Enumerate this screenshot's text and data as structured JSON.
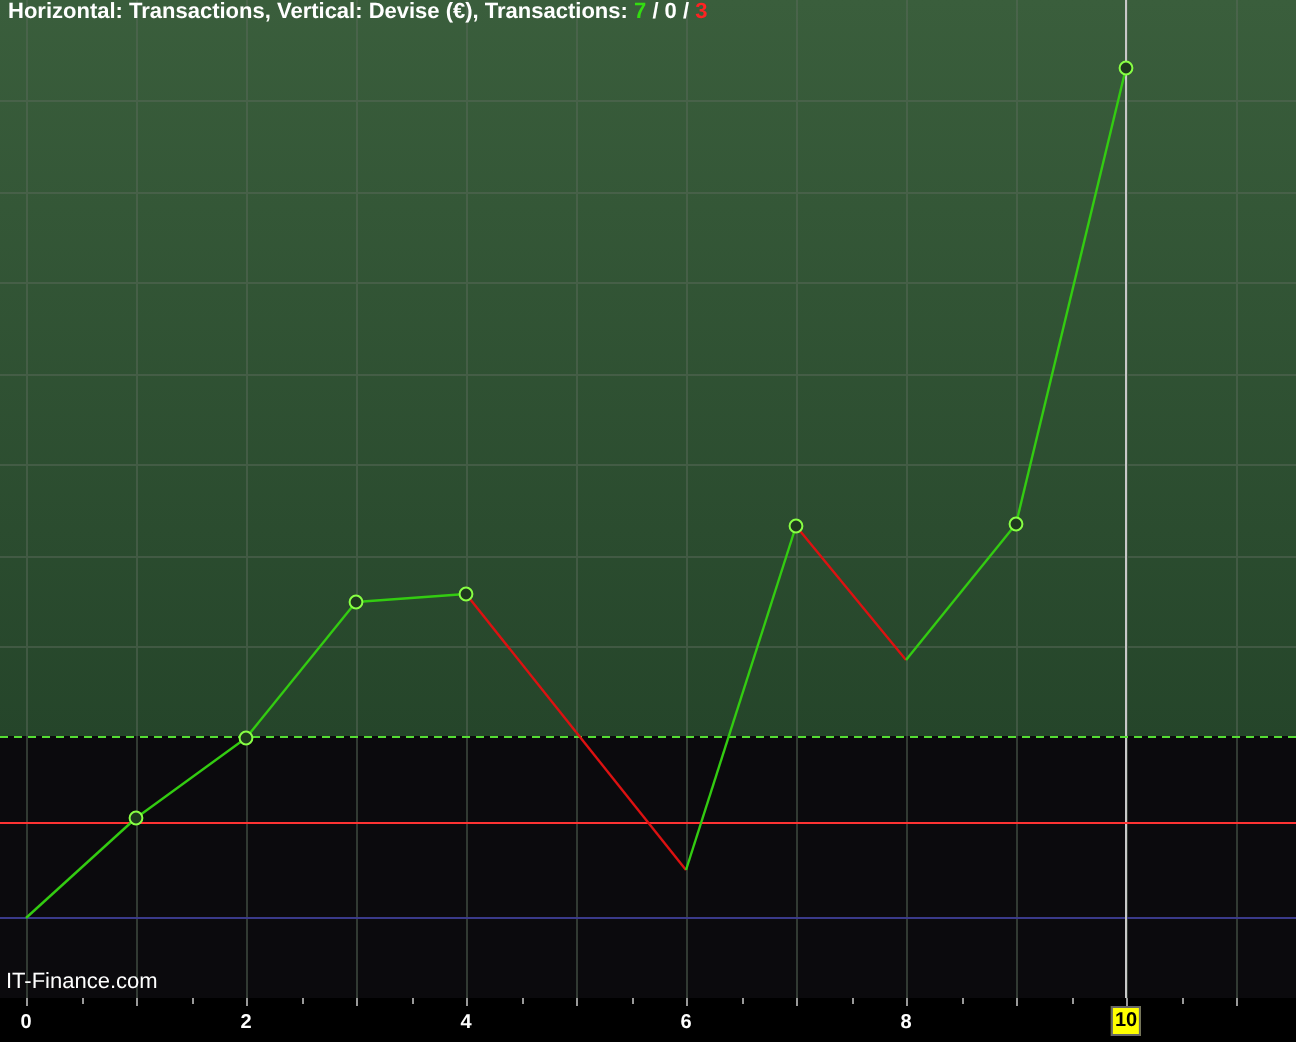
{
  "chart": {
    "title": {
      "label": "Horizontal: Transactions, Vertical: Devise (€), Transactions:",
      "up_count": "7",
      "separator": "/ 0 /",
      "down_count": "3"
    },
    "watermark": "IT-Finance.com",
    "x_axis_labels": [
      {
        "text": "0",
        "selected": false
      },
      {
        "text": "2",
        "selected": false
      },
      {
        "text": "4",
        "selected": false
      },
      {
        "text": "6",
        "selected": false
      },
      {
        "text": "8",
        "selected": false
      },
      {
        "text": "10",
        "selected": true
      }
    ]
  }
}
